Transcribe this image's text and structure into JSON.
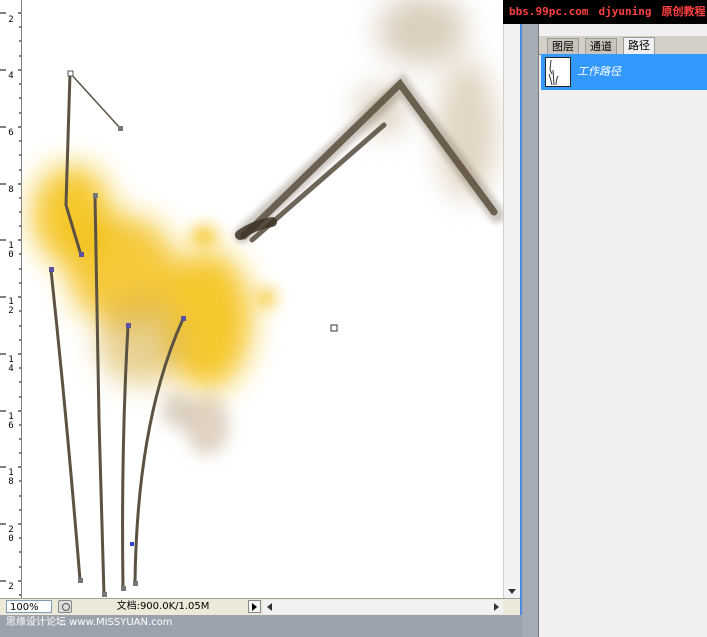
{
  "watermark_top": {
    "site": "bbs.99pc.com",
    "user": "djyuning",
    "label": "原创教程"
  },
  "ruler": {
    "labels": [
      "2",
      "4",
      "6",
      "8",
      "1\n0",
      "1\n2",
      "1\n4",
      "1\n6",
      "1\n8",
      "2\n0",
      "2"
    ]
  },
  "status_bar": {
    "zoom": "100%",
    "doc_info": "文档:900.0K/1.05M"
  },
  "paths_panel": {
    "tabs": [
      "图层",
      "通道",
      "路径"
    ],
    "active_tab": "路径",
    "items": [
      {
        "name": "工作路径",
        "selected": true
      }
    ]
  },
  "watermark_bottom": {
    "text": "思缘设计论坛 www.MISSYUAN.com"
  },
  "colors": {
    "yellow_ink": "#f4c21a",
    "brown_ink": "#5a4e3c",
    "selection": "#3399ff"
  },
  "icons": [
    "scroll-down-arrow-icon",
    "scroll-left-arrow-icon",
    "scroll-right-arrow-icon",
    "status-menu-arrow-icon",
    "status-icon"
  ]
}
